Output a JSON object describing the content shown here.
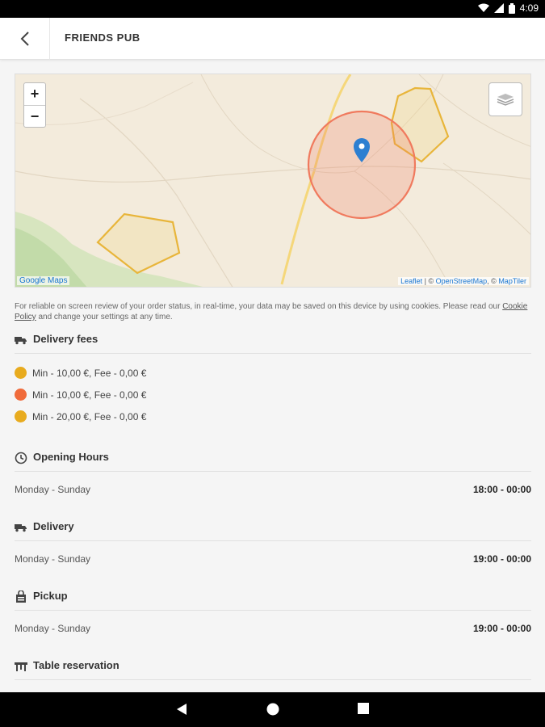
{
  "status_bar": {
    "time": "4:09"
  },
  "header": {
    "title": "FRIENDS PUB"
  },
  "map": {
    "zoom_in": "+",
    "zoom_out": "−",
    "google_link": "Google Maps",
    "attribution": {
      "leaflet": "Leaflet",
      "sep1": " | © ",
      "osm": "OpenStreetMap",
      "sep2": ", © ",
      "maptiler": "MapTiler"
    },
    "polygon_color": "#e8b53a",
    "circle_color": "#f07a5e",
    "marker_color": "#2d7fd1"
  },
  "cookie_notice": {
    "text": "For reliable on screen review of your order status, in real-time, your data may be saved on this device by using cookies. Please read our ",
    "link": "Cookie Policy",
    "suffix": " and change your settings at any time."
  },
  "delivery_fees": {
    "title": "Delivery fees",
    "items": [
      {
        "label": "Min - 10,00 €, Fee - 0,00 €",
        "color": "#e8ab1e"
      },
      {
        "label": "Min - 10,00 €, Fee - 0,00 €",
        "color": "#f06b3b"
      },
      {
        "label": "Min - 20,00 €, Fee - 0,00 €",
        "color": "#e8ab1e"
      }
    ]
  },
  "opening_hours": {
    "title": "Opening Hours",
    "days": "Monday - Sunday",
    "time": "18:00 - 00:00"
  },
  "delivery": {
    "title": "Delivery",
    "days": "Monday - Sunday",
    "time": "19:00 - 00:00"
  },
  "pickup": {
    "title": "Pickup",
    "days": "Monday - Sunday",
    "time": "19:00 - 00:00"
  },
  "table_reservation": {
    "title": "Table reservation"
  }
}
